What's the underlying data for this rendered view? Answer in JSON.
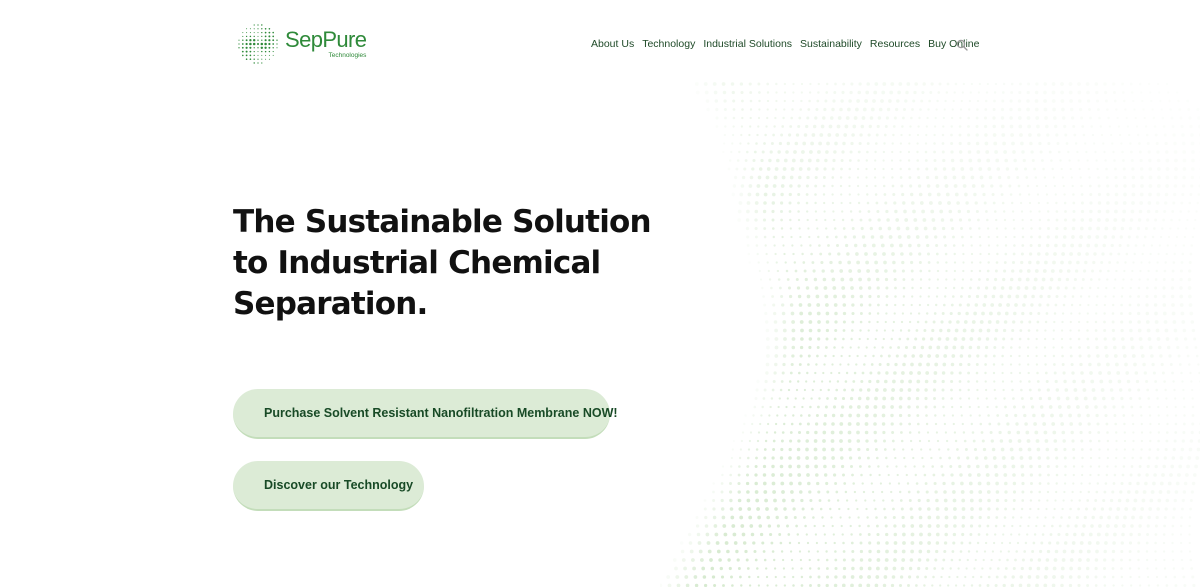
{
  "brand": {
    "name": "SepPure",
    "subtitle": "Technologies",
    "color": "#2f8a3a"
  },
  "nav": {
    "items": [
      {
        "label": "About Us"
      },
      {
        "label": "Technology"
      },
      {
        "label": "Industrial Solutions"
      },
      {
        "label": "Sustainability"
      },
      {
        "label": "Resources"
      },
      {
        "label": "Buy Online"
      }
    ],
    "search_icon": "search-icon"
  },
  "hero": {
    "title_lines": [
      "The Sustainable Solution",
      "to Industrial Chemical",
      "Separation."
    ],
    "primary_cta": "Purchase Solvent Resistant Nanofiltration Membrane NOW!",
    "secondary_cta": "Discover our Technology"
  },
  "colors": {
    "button_bg": "#dcebd6",
    "button_text": "#184a26",
    "dot_pattern": "#cfe6c7"
  }
}
